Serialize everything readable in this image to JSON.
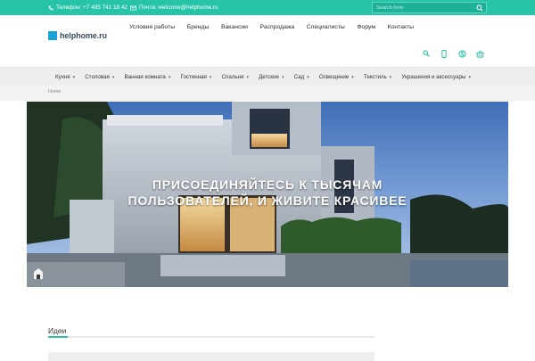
{
  "topbar": {
    "phone_text": "Телефон: +7 495 741 18 42",
    "email_text": "Почта: welcome@helphome.ru",
    "search_placeholder": "Search here"
  },
  "logo": {
    "text": "helphome.ru",
    "color": "#1aa3d6"
  },
  "main_nav": [
    "Условия работы",
    "Бренды",
    "Вакансии",
    "Распродажа",
    "Специалисты",
    "Форум",
    "Контакты"
  ],
  "header_icons": [
    "search-icon",
    "mobile-icon",
    "skype-icon",
    "basket-icon"
  ],
  "category_nav": [
    "Кухня",
    "Столовая",
    "Ванная комната",
    "Гостинная",
    "Спальня",
    "Детские",
    "Сад",
    "Освещение",
    "Текстиль",
    "Украшения и аксессуары"
  ],
  "breadcrumb": "Home",
  "hero": {
    "line1": "ПРИСОЕДИНЯЙТЕСЬ К ТЫСЯЧАМ",
    "line2": "ПОЛЬЗОВАТЕЛЕЙ, И ЖИВИТЕ КРАСИВЕЕ"
  },
  "ideas": {
    "title": "Идеи"
  },
  "colors": {
    "accent": "#27c4a8",
    "brand": "#1aa3d6"
  }
}
